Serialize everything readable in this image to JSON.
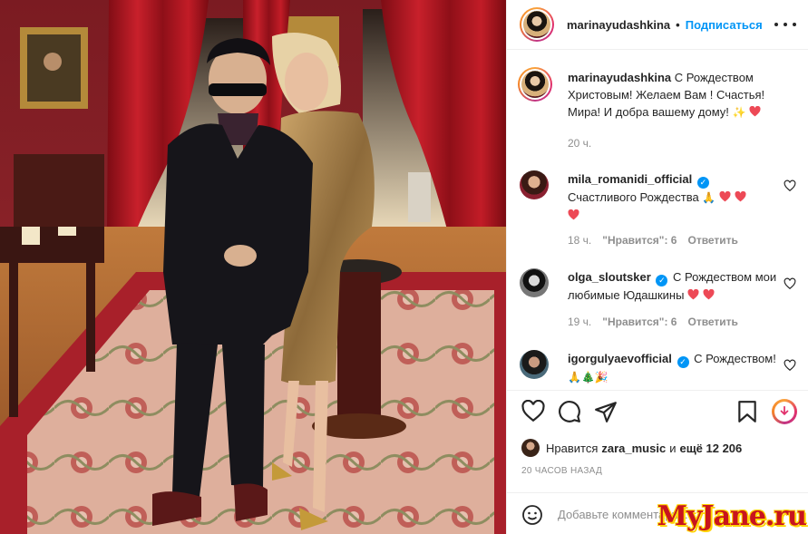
{
  "post": {
    "username": "marinayudashkina",
    "separator": "•",
    "follow_label": "Подписаться",
    "caption": "С Рождеством Христовым! Желаем Вам ! Счастья! Мира! И добра вашему дому!",
    "caption_time": "20 ч."
  },
  "comments": [
    {
      "username": "mila_romanidi_official",
      "verified": true,
      "text": "Счастливого Рождества",
      "emoji": [
        "pray",
        "red-heart",
        "red-heart",
        "red-heart"
      ],
      "time": "18 ч.",
      "likes_label": "\"Нравится\": 6",
      "reply_label": "Ответить"
    },
    {
      "username": "olga_sloutsker",
      "verified": true,
      "text": "С Рождеством мои любимые Юдашкины",
      "emoji": [
        "red-heart",
        "red-heart"
      ],
      "time": "19 ч.",
      "likes_label": "\"Нравится\": 6",
      "reply_label": "Ответить"
    },
    {
      "username": "igorgulyaevofficial",
      "verified": true,
      "text": "С Рождеством!",
      "emoji": [
        "pray",
        "christmas-tree",
        "party-popper"
      ],
      "time": "",
      "likes_label": "",
      "reply_label": ""
    }
  ],
  "likes": {
    "prefix": "Нравится",
    "user": "zara_music",
    "conj": "и",
    "others": "ещё 12 206"
  },
  "timestamp": "20 ЧАСОВ НАЗАД",
  "comment_box": {
    "placeholder": "Добавьте комментарий..."
  },
  "watermark": "MyJane.ru",
  "colors": {
    "accent": "#0095f6",
    "heart": "#ed4956",
    "text": "#262626",
    "muted": "#8e8e8e",
    "wall": "#8a1f26",
    "curtain": "#b3141f",
    "carpet": "#a8202a"
  }
}
